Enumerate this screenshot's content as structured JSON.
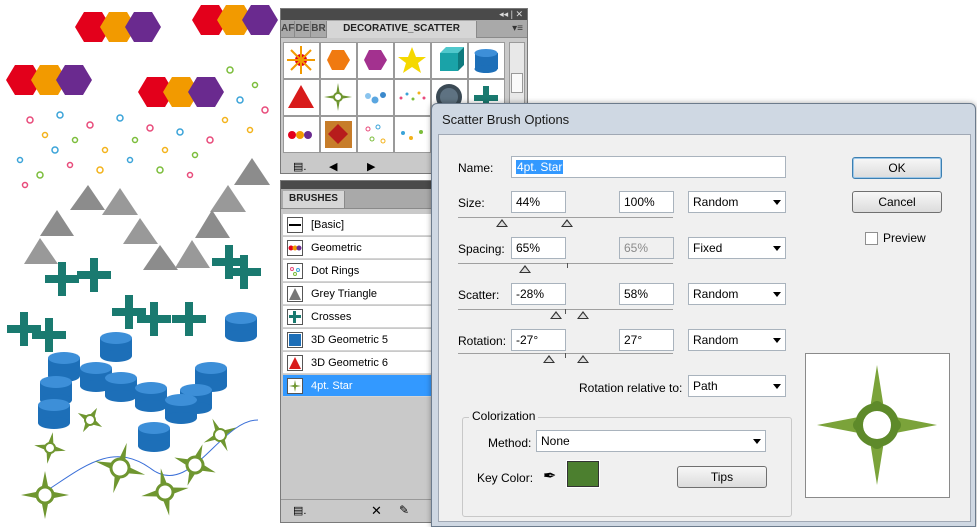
{
  "swatch_panel": {
    "titlebar_glyph": "◂◂ | ✕",
    "tabs": [
      "AF",
      "DE",
      "BR",
      "DECORATIVE_SCATTER"
    ],
    "menu_icon": "panel-menu-icon",
    "swatches": [
      {
        "name": "sunburst-swatch"
      },
      {
        "name": "orange-hexagon-swatch"
      },
      {
        "name": "purple-hexagon-swatch"
      },
      {
        "name": "yellow-star-swatch"
      },
      {
        "name": "teal-cube-swatch"
      },
      {
        "name": "blue-cylinder-swatch"
      },
      {
        "name": "red-pyramid-swatch"
      },
      {
        "name": "green-star-swatch"
      },
      {
        "name": "blue-dots-swatch"
      },
      {
        "name": "confetti-swatch"
      },
      {
        "name": "dark-circle-swatch"
      },
      {
        "name": "teal-cross-swatch"
      },
      {
        "name": "colored-balls-swatch"
      },
      {
        "name": "red-diamond-swatch"
      },
      {
        "name": "dot-rings-swatch"
      },
      {
        "name": "scatter-dots-swatch"
      }
    ]
  },
  "brushes_panel": {
    "tab_label": "BRUSHES",
    "items": [
      {
        "label": "[Basic]",
        "icon": "basic-brush-icon"
      },
      {
        "label": "Geometric",
        "icon": "geometric-brush-icon"
      },
      {
        "label": "Dot Rings",
        "icon": "dot-rings-brush-icon"
      },
      {
        "label": "Grey Triangle",
        "icon": "grey-triangle-brush-icon"
      },
      {
        "label": "Crosses",
        "icon": "crosses-brush-icon"
      },
      {
        "label": "3D Geometric 5",
        "icon": "3d-geometric-5-brush-icon"
      },
      {
        "label": "3D Geometric 6",
        "icon": "3d-geometric-6-brush-icon"
      },
      {
        "label": "4pt. Star",
        "icon": "4pt-star-brush-icon",
        "selected": true
      }
    ]
  },
  "dialog": {
    "title": "Scatter Brush Options",
    "name_label": "Name:",
    "name_value": "4pt. Star",
    "size": {
      "label": "Size:",
      "min": "44%",
      "max": "100%",
      "method": "Random"
    },
    "spacing": {
      "label": "Spacing:",
      "min": "65%",
      "max": "65%",
      "method": "Fixed"
    },
    "scatter": {
      "label": "Scatter:",
      "min": "-28%",
      "max": "58%",
      "method": "Random"
    },
    "rotation": {
      "label": "Rotation:",
      "min": "-27°",
      "max": "27°",
      "method": "Random"
    },
    "rotation_relative_label": "Rotation relative to:",
    "rotation_relative_value": "Path",
    "colorization_title": "Colorization",
    "method_label": "Method:",
    "method_value": "None",
    "key_color_label": "Key Color:",
    "key_color_hex": "#4c7f2f",
    "tips_label": "Tips",
    "ok_label": "OK",
    "cancel_label": "Cancel",
    "preview_label": "Preview",
    "preview_checked": false
  },
  "colors": {
    "selection": "#3399ff",
    "star_green": "#6f9630",
    "hex_red": "#e3001b",
    "hex_orange": "#f29a00",
    "hex_purple": "#6a2a8f",
    "cylinder_blue": "#1d6fb8",
    "cross_teal": "#1a7a70",
    "triangle_grey": "#8c8c8c"
  }
}
